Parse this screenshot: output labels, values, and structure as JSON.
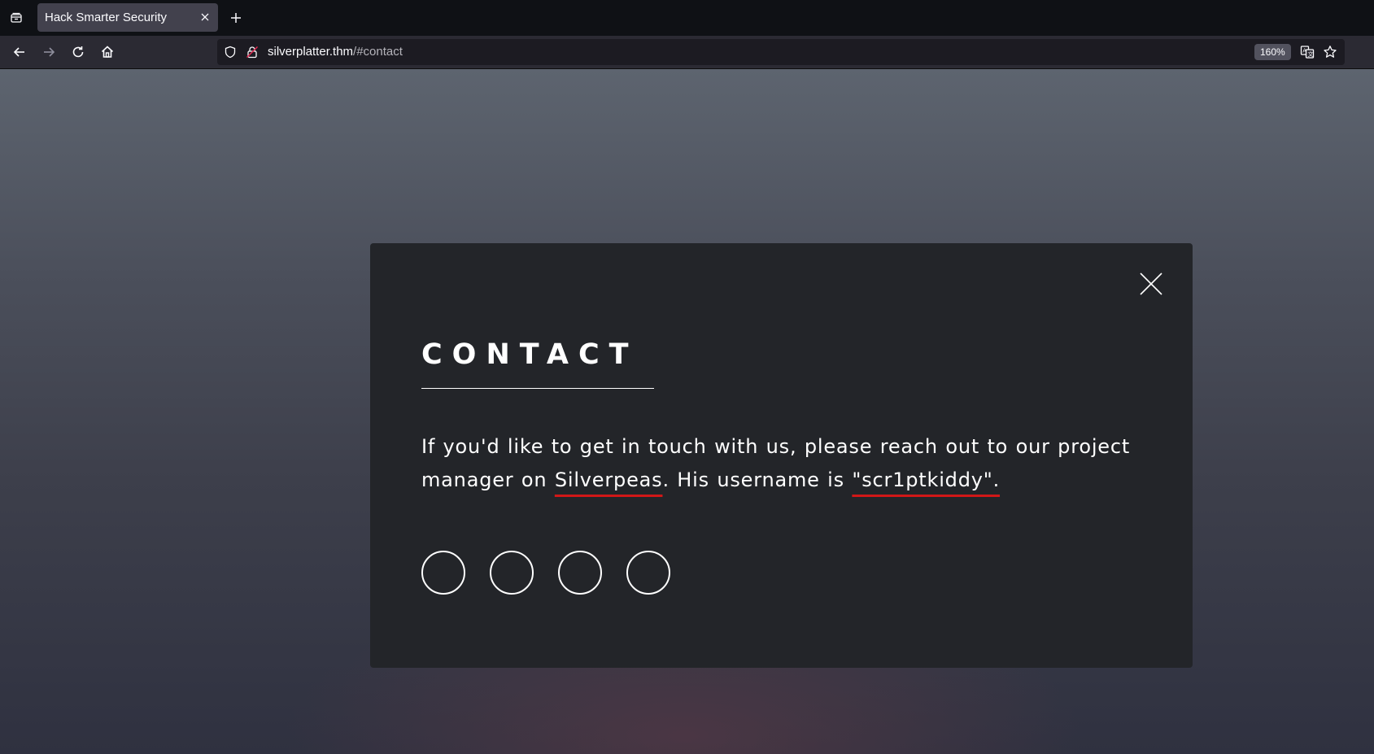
{
  "browser": {
    "tab": {
      "title": "Hack Smarter Security"
    },
    "url": {
      "host": "silverplatter.thm",
      "path": "/#contact"
    },
    "zoom": "160%"
  },
  "modal": {
    "title": "CONTACT",
    "text_before": "If you'd like to get in touch with us, please reach out to our project manager on ",
    "highlight_1": "Silverpeas",
    "text_middle": ". His username is ",
    "highlight_2": "\"scr1ptkiddy\".",
    "social_links": 4
  },
  "colors": {
    "modal_background": "#232529",
    "highlight_underline": "#d11717",
    "text": "#ffffff"
  }
}
